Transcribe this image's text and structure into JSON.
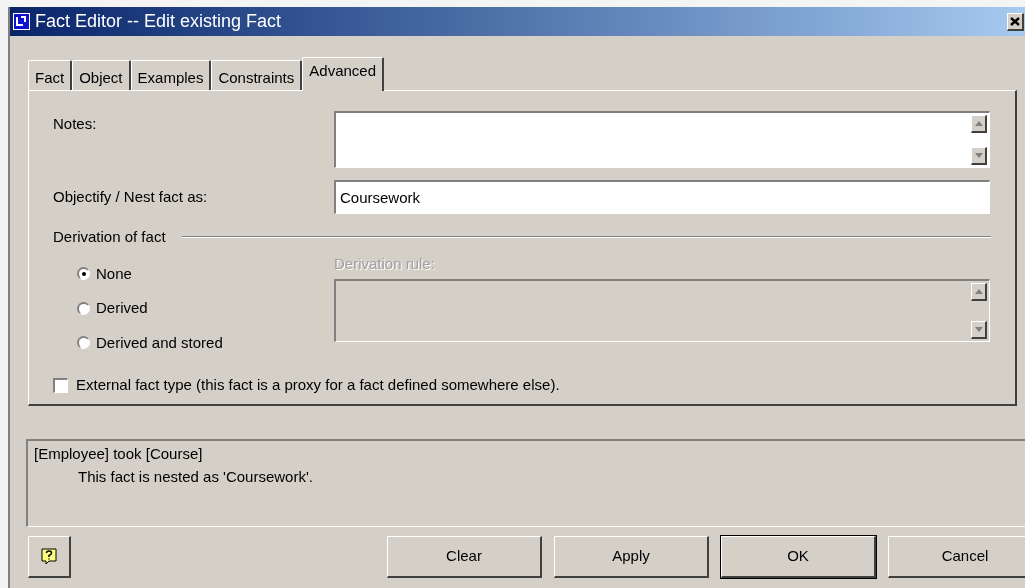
{
  "window": {
    "title": "Fact Editor -- Edit existing Fact"
  },
  "tabs": [
    {
      "label": "Fact",
      "selected": false
    },
    {
      "label": "Object",
      "selected": false
    },
    {
      "label": "Examples",
      "selected": false
    },
    {
      "label": "Constraints",
      "selected": false
    },
    {
      "label": "Advanced",
      "selected": true
    }
  ],
  "notes": {
    "label": "Notes:"
  },
  "objectify": {
    "label": "Objectify / Nest fact as:",
    "value": "Coursework"
  },
  "derivation": {
    "heading": "Derivation of fact",
    "options": [
      {
        "label": "None",
        "selected": true
      },
      {
        "label": "Derived",
        "selected": false
      },
      {
        "label": "Derived and stored",
        "selected": false
      }
    ],
    "rule": {
      "label": "Derivation rule:",
      "disabled": true
    }
  },
  "external": {
    "label": "External fact type (this fact is a proxy for a fact defined somewhere else).",
    "checked": false
  },
  "summary": {
    "lines": [
      "[Employee] took [Course]",
      "This fact is nested as 'Coursework'."
    ]
  },
  "buttons": [
    {
      "label": "Clear",
      "default": false
    },
    {
      "label": "Apply",
      "default": false
    },
    {
      "label": "OK",
      "default": true
    },
    {
      "label": "Cancel",
      "default": false
    }
  ]
}
